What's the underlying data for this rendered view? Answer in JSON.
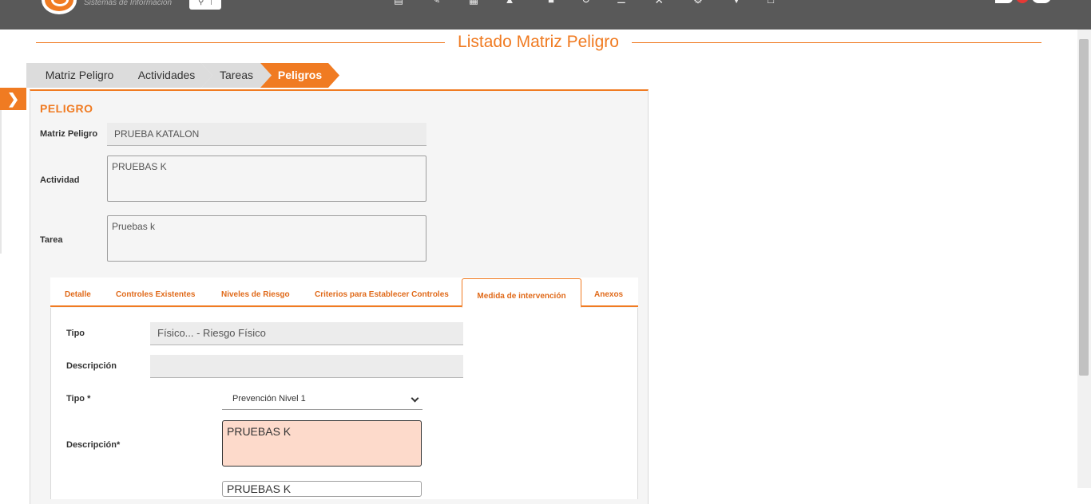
{
  "header": {
    "logo_caption": "Sistemas de Información",
    "search_icon": "search-icon",
    "nav_icons": [
      "document-icon",
      "edit-icon",
      "grid-icon",
      "group-icon",
      "box-icon",
      "history-icon",
      "list-icon",
      "tools-icon",
      "gear-icon",
      "location-icon",
      "chat-icon"
    ]
  },
  "page": {
    "title": "Listado Matriz Peligro"
  },
  "breadcrumb": [
    "Matriz Peligro",
    "Actividades",
    "Tareas",
    "Peligros"
  ],
  "panel": {
    "section_title": "PELIGRO",
    "matriz_label": "Matriz Peligro",
    "matriz_value": "PRUEBA KATALON",
    "actividad_label": "Actividad",
    "actividad_value": "PRUEBAS K",
    "tarea_label": "Tarea",
    "tarea_value": "Pruebas k"
  },
  "tabs": [
    "Detalle",
    "Controles Existentes",
    "Niveles de Riesgo",
    "Criterios para Establecer Controles",
    "Medida de intervención",
    "Anexos"
  ],
  "form": {
    "tipo_label": "Tipo",
    "tipo_value": "Físico... - Riesgo Físico",
    "descripcion_label": "Descripción",
    "descripcion_value": "",
    "tipo_req_label": "Tipo *",
    "tipo_req_value": "Prevención Nivel 1",
    "descripcion_req_label": "Descripción*",
    "descripcion_req_value": "PRUEBAS K",
    "next_value": "PRUEBAS K"
  },
  "colors": {
    "accent": "#f07b22",
    "topbar": "#595959",
    "error_fill": "#fddacb"
  }
}
